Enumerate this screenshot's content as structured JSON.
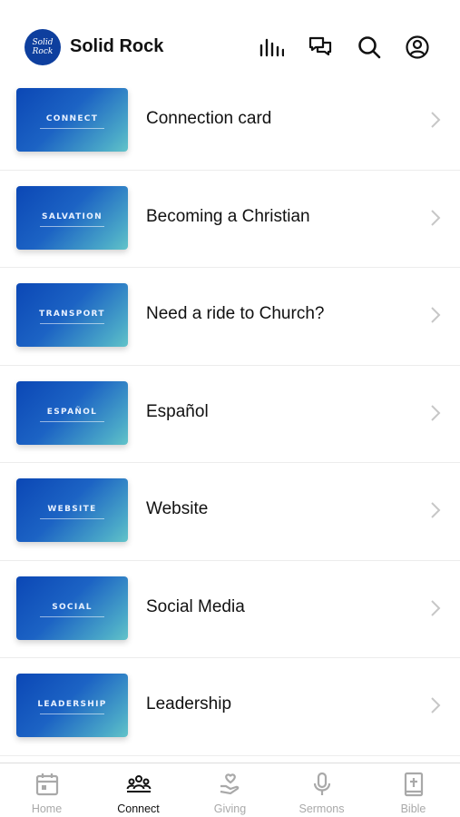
{
  "header": {
    "logo_text": "Solid Rock",
    "title": "Solid Rock",
    "icons": [
      "stats-icon",
      "chat-icon",
      "search-icon",
      "profile-icon"
    ]
  },
  "list": [
    {
      "thumb": "CONNECT",
      "title": "Connection card"
    },
    {
      "thumb": "SALVATION",
      "title": "Becoming a Christian"
    },
    {
      "thumb": "TRANSPORT",
      "title": "Need a ride to Church?"
    },
    {
      "thumb": "ESPAÑOL",
      "title": "Español"
    },
    {
      "thumb": "WEBSITE",
      "title": "Website"
    },
    {
      "thumb": "SOCIAL",
      "title": "Social Media"
    },
    {
      "thumb": "LEADERSHIP",
      "title": "Leadership"
    }
  ],
  "tabs": [
    {
      "label": "Home",
      "icon": "calendar-icon",
      "active": false
    },
    {
      "label": "Connect",
      "icon": "group-icon",
      "active": true
    },
    {
      "label": "Giving",
      "icon": "giving-icon",
      "active": false
    },
    {
      "label": "Sermons",
      "icon": "microphone-icon",
      "active": false
    },
    {
      "label": "Bible",
      "icon": "bible-icon",
      "active": false
    }
  ],
  "colors": {
    "brand": "#0e3f9e",
    "thumb_gradient_start": "#0b47b5",
    "thumb_gradient_end": "#62c3c9",
    "tab_inactive": "#a9a9a9",
    "tab_active": "#111111"
  }
}
